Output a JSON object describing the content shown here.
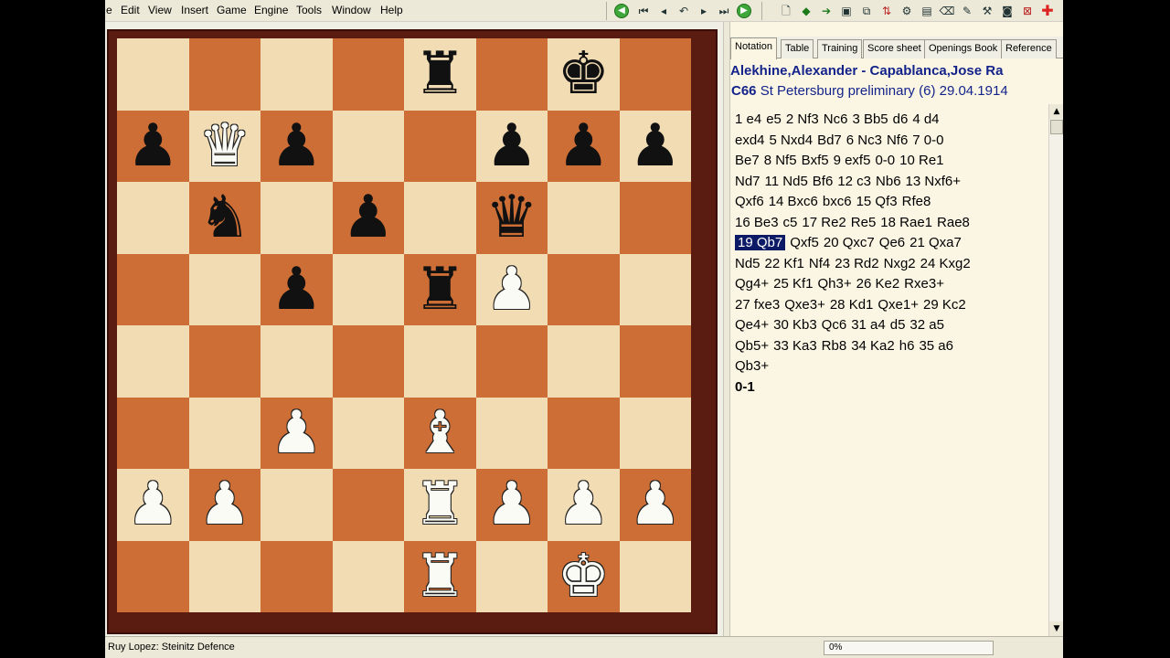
{
  "menu": [
    "e",
    "Edit",
    "View",
    "Insert",
    "Game",
    "Engine",
    "Tools",
    "Window",
    "Help"
  ],
  "toolbar": {
    "nav_buttons": [
      "back-green",
      "first",
      "prev",
      "undo",
      "next",
      "last",
      "forward-green"
    ],
    "tool_icons": [
      "new-game-icon",
      "arrow-left-icon",
      "arrow-right-icon",
      "save-icon",
      "board-copy-icon",
      "transfer-icon",
      "settings-icon",
      "paste-icon",
      "eraser-icon",
      "pencil-icon",
      "tools-icon",
      "photo-icon",
      "flip-board-icon",
      "plus-icon"
    ]
  },
  "tabs": [
    "Notation",
    "Table",
    "Training",
    "Score sheet",
    "Openings Book",
    "Reference"
  ],
  "active_tab": "Notation",
  "game": {
    "players": "Alekhine,Alexander - Capablanca,Jose Ra",
    "eco": "C66",
    "event": "St Petersburg preliminary (6) 29.04.1914"
  },
  "moves": [
    [
      "1 e4",
      "e5",
      "2 Nf3",
      "Nc6",
      "3 Bb5",
      "d6",
      "4 d4"
    ],
    [
      "exd4",
      "5 Nxd4",
      "Bd7",
      "6 Nc3",
      "Nf6",
      "7 0-0"
    ],
    [
      "Be7",
      "8 Nf5",
      "Bxf5",
      "9 exf5",
      "0-0",
      "10 Re1"
    ],
    [
      "Nd7",
      "11 Nd5",
      "Bf6",
      "12 c3",
      "Nb6",
      "13 Nxf6+"
    ],
    [
      "Qxf6",
      "14 Bxc6",
      "bxc6",
      "15 Qf3",
      "Rfe8"
    ],
    [
      "16 Be3",
      "c5",
      "17 Re2",
      "Re5",
      "18 Rae1",
      "Rae8"
    ],
    [
      "19 Qb7",
      "Qxf5",
      "20 Qxc7",
      "Qe6",
      "21 Qxa7"
    ],
    [
      "Nd5",
      "22 Kf1",
      "Nf4",
      "23 Rd2",
      "Nxg2",
      "24 Kxg2"
    ],
    [
      "Qg4+",
      "25 Kf1",
      "Qh3+",
      "26 Ke2",
      "Rxe3+"
    ],
    [
      "27 fxe3",
      "Qxe3+",
      "28 Kd1",
      "Qxe1+",
      "29 Kc2"
    ],
    [
      "Qe4+",
      "30 Kb3",
      "Qc6",
      "31 a4",
      "d5",
      "32 a5"
    ],
    [
      "Qb5+",
      "33 Ka3",
      "Rb8",
      "34 Ka2",
      "h6",
      "35 a6"
    ],
    [
      "Qb3+"
    ]
  ],
  "current_move": "19 Qb7",
  "result": "0-1",
  "board": [
    [
      "",
      "",
      "",
      "",
      "r",
      "",
      "k",
      ""
    ],
    [
      "p",
      "Q",
      "p",
      "",
      "",
      "p",
      "p",
      "p"
    ],
    [
      "",
      "n",
      "",
      "p",
      "",
      "q",
      "",
      ""
    ],
    [
      "",
      "",
      "p",
      "",
      "r",
      "P",
      "",
      ""
    ],
    [
      "",
      "",
      "",
      "",
      "",
      "",
      "",
      ""
    ],
    [
      "",
      "",
      "P",
      "",
      "B",
      "",
      "",
      ""
    ],
    [
      "P",
      "P",
      "",
      "",
      "R",
      "P",
      "P",
      "P"
    ],
    [
      "",
      "",
      "",
      "",
      "R",
      "",
      "K",
      ""
    ]
  ],
  "colors": {
    "light_square": "#f1dcb4",
    "dark_square": "#cd6e36",
    "frame": "#5a1c10",
    "header_text": "#14238a",
    "highlight": "#0d1a66"
  },
  "status": {
    "opening": "Ruy Lopez: Steinitz Defence",
    "progress_text": "0%",
    "progress_value": 0
  }
}
